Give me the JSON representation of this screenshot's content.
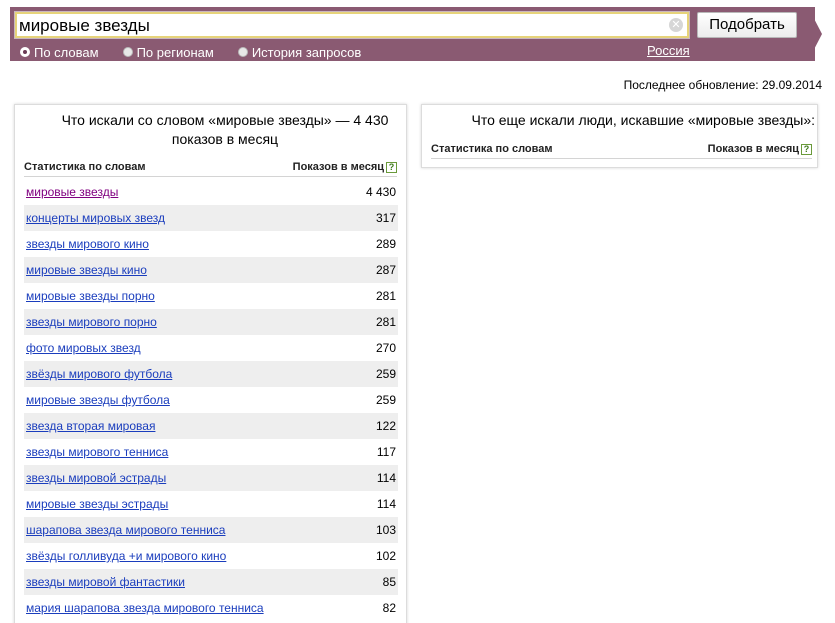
{
  "search": {
    "value": "мировые звезды",
    "clear_glyph": "✕",
    "submit_label": "Подобрать"
  },
  "modes": [
    {
      "label": "По словам",
      "checked": true
    },
    {
      "label": "По регионам",
      "checked": false
    },
    {
      "label": "История запросов",
      "checked": false
    }
  ],
  "region": "Россия",
  "last_update": "Последнее обновление: 29.09.2014",
  "left_panel": {
    "title": "Что искали со словом «мировые звезды» — 4 430 показов в месяц",
    "col_keyword": "Статистика по словам",
    "col_count": "Показов в месяц",
    "help_glyph": "?",
    "rows": [
      {
        "phrase": "мировые звезды",
        "count": "4 430"
      },
      {
        "phrase": "концерты мировых звезд",
        "count": "317"
      },
      {
        "phrase": "звезды мирового кино",
        "count": "289"
      },
      {
        "phrase": "мировые звезды кино",
        "count": "287"
      },
      {
        "phrase": "мировые звезды порно",
        "count": "281"
      },
      {
        "phrase": "звезды мирового порно",
        "count": "281"
      },
      {
        "phrase": "фото мировых звезд",
        "count": "270"
      },
      {
        "phrase": "звёзды мирового футбола",
        "count": "259"
      },
      {
        "phrase": "мировые звезды футбола",
        "count": "259"
      },
      {
        "phrase": "звезда вторая мировая",
        "count": "122"
      },
      {
        "phrase": "звезды мирового тенниса",
        "count": "117"
      },
      {
        "phrase": "звезды мировой эстрады",
        "count": "114"
      },
      {
        "phrase": "мировые звезды эстрады",
        "count": "114"
      },
      {
        "phrase": "шарапова звезда мирового тенниса",
        "count": "103"
      },
      {
        "phrase": "звёзды голливуда +и мирового кино",
        "count": "102"
      },
      {
        "phrase": "звезды мировой фантастики",
        "count": "85"
      },
      {
        "phrase": "мария шарапова звезда мирового тенниса",
        "count": "82"
      }
    ]
  },
  "right_panel": {
    "title": "Что еще искали люди, искавшие «мировые звезды»:",
    "col_keyword": "Статистика по словам",
    "col_count": "Показов в месяц",
    "help_glyph": "?"
  },
  "colors": {
    "header": "#8a5a72",
    "link": "#1a3dbd",
    "visited_link": "#800080"
  }
}
